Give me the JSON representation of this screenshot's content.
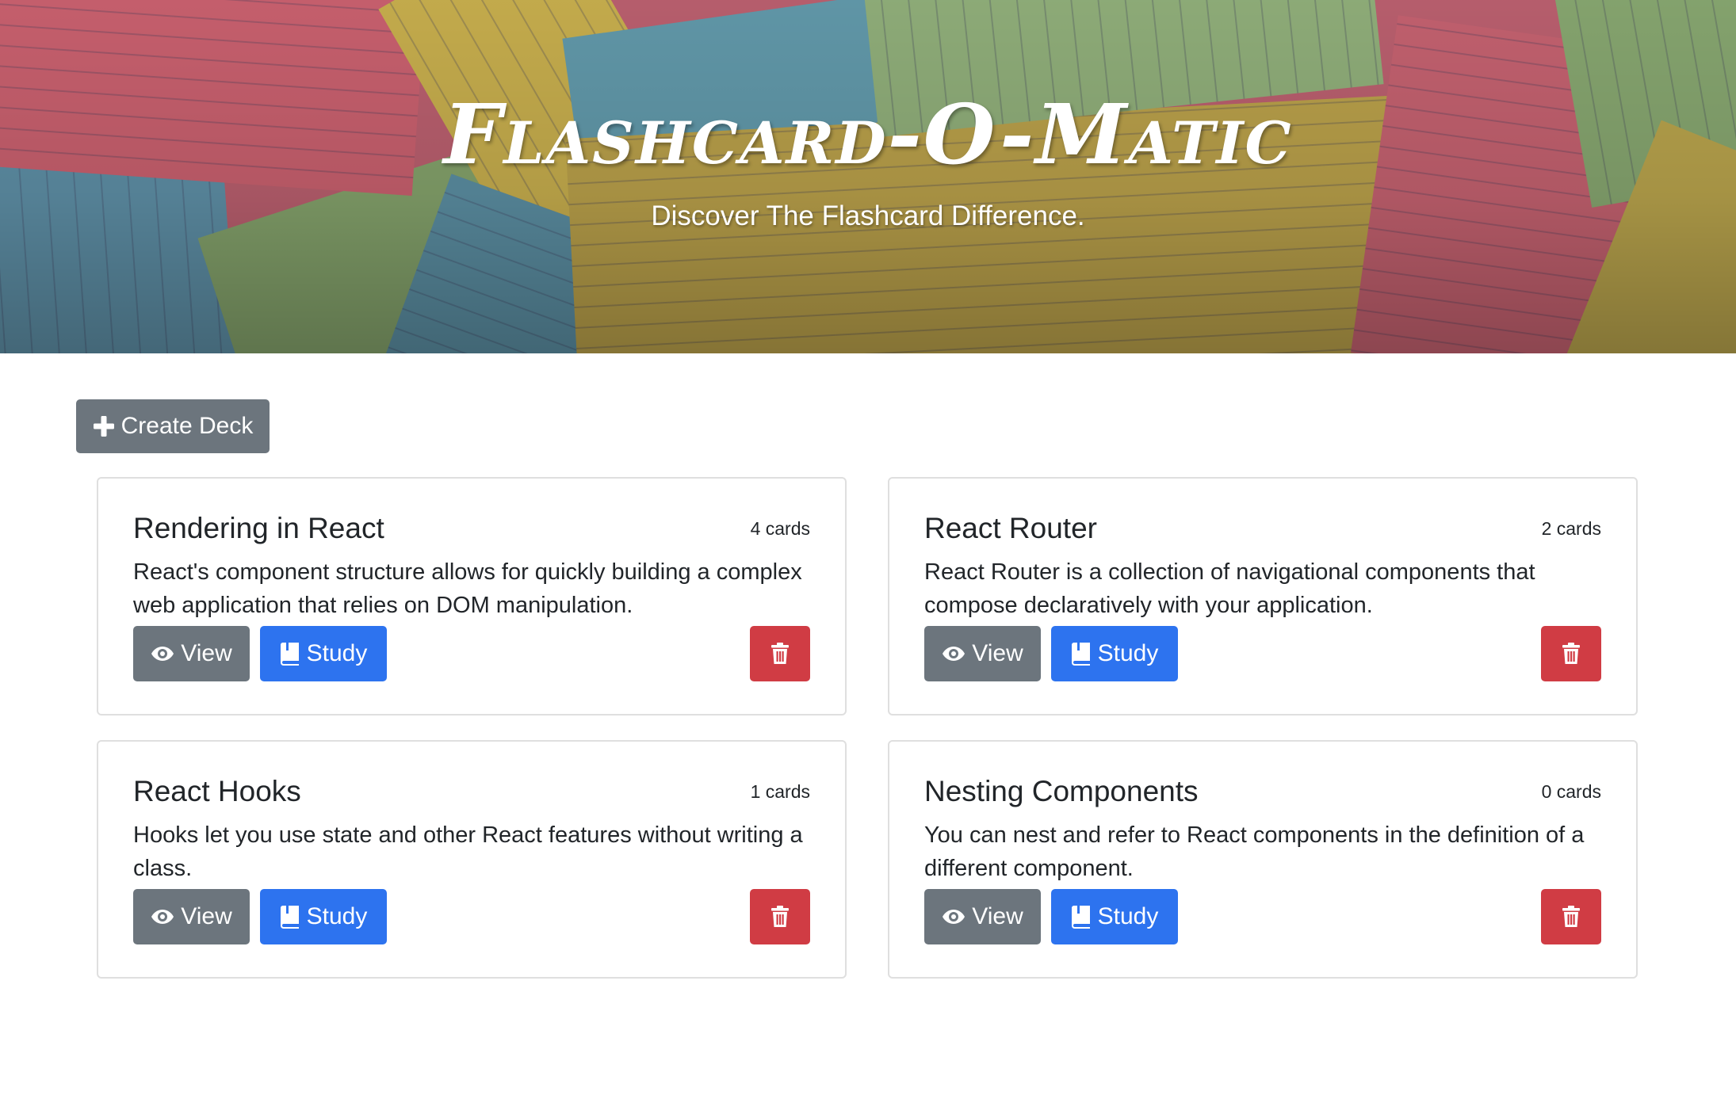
{
  "hero": {
    "title": "Flashcard-O-Matic",
    "subtitle": "Discover The Flashcard Difference."
  },
  "toolbar": {
    "create_label": "Create Deck",
    "create_icon": "plus-icon"
  },
  "decks": [
    {
      "name": "Rendering in React",
      "count": "4 cards",
      "description": "React's component structure allows for quickly building a complex web application that relies on DOM manipulation.",
      "view_label": "View",
      "study_label": "Study"
    },
    {
      "name": "React Router",
      "count": "2 cards",
      "description": "React Router is a collection of navigational components that compose declaratively with your application.",
      "view_label": "View",
      "study_label": "Study"
    },
    {
      "name": "React Hooks",
      "count": "1 cards",
      "description": "Hooks let you use state and other React features without writing a class.",
      "view_label": "View",
      "study_label": "Study"
    },
    {
      "name": "Nesting Components",
      "count": "0 cards",
      "description": "You can nest and refer to React components in the definition of a different component.",
      "view_label": "View",
      "study_label": "Study"
    }
  ],
  "icons": {
    "view": "eye-icon",
    "study": "book-icon",
    "delete": "trash-icon"
  },
  "colors": {
    "secondary": "#6c757d",
    "primary": "#2d73ef",
    "danger": "#d03c44",
    "card_border": "#dfdfdf"
  }
}
